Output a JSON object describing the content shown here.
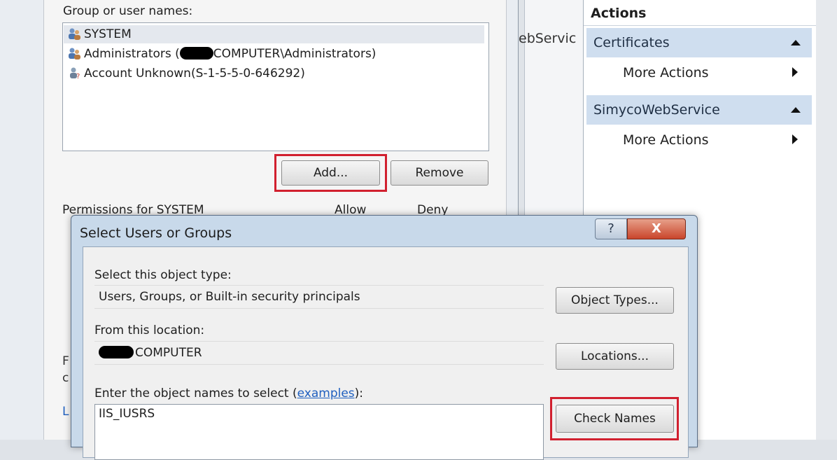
{
  "middle": {
    "truncated_text": "ebServic"
  },
  "actions": {
    "header": "Actions",
    "sections": [
      {
        "title": "Certificates",
        "item": "More Actions"
      },
      {
        "title": "SimycoWebService",
        "item": "More Actions"
      }
    ]
  },
  "permissions": {
    "group_label": "Group or user names:",
    "users": [
      {
        "name": "SYSTEM"
      },
      {
        "prefix": "Administrators (",
        "suffix": "COMPUTER\\Administrators)"
      },
      {
        "name": "Account Unknown(S-1-5-5-0-646292)"
      }
    ],
    "add_label": "Add...",
    "remove_label": "Remove",
    "perm_for_label": "Permissions for SYSTEM",
    "allow_label": "Allow",
    "deny_label": "Deny",
    "trunc_f": "F",
    "trunc_c": "c",
    "trunc_l": "L"
  },
  "dialog": {
    "title": "Select Users or Groups",
    "help_glyph": "?",
    "close_glyph": "X",
    "object_type_label": "Select this object type:",
    "object_type_value": "Users, Groups, or Built-in security principals",
    "object_types_button": "Object Types...",
    "location_label": "From this location:",
    "location_value": "COMPUTER",
    "locations_button": "Locations...",
    "enter_label_prefix": "Enter the object names to select (",
    "enter_label_link": "examples",
    "enter_label_suffix": "):",
    "object_names_value": "IIS_IUSRS",
    "check_names_button": "Check Names"
  },
  "colors": {
    "highlight_box": "#d1202f",
    "section_header_bg": "#cfdeef",
    "dialog_frame": "#c8d9ea",
    "close_button": "#c9452b"
  }
}
